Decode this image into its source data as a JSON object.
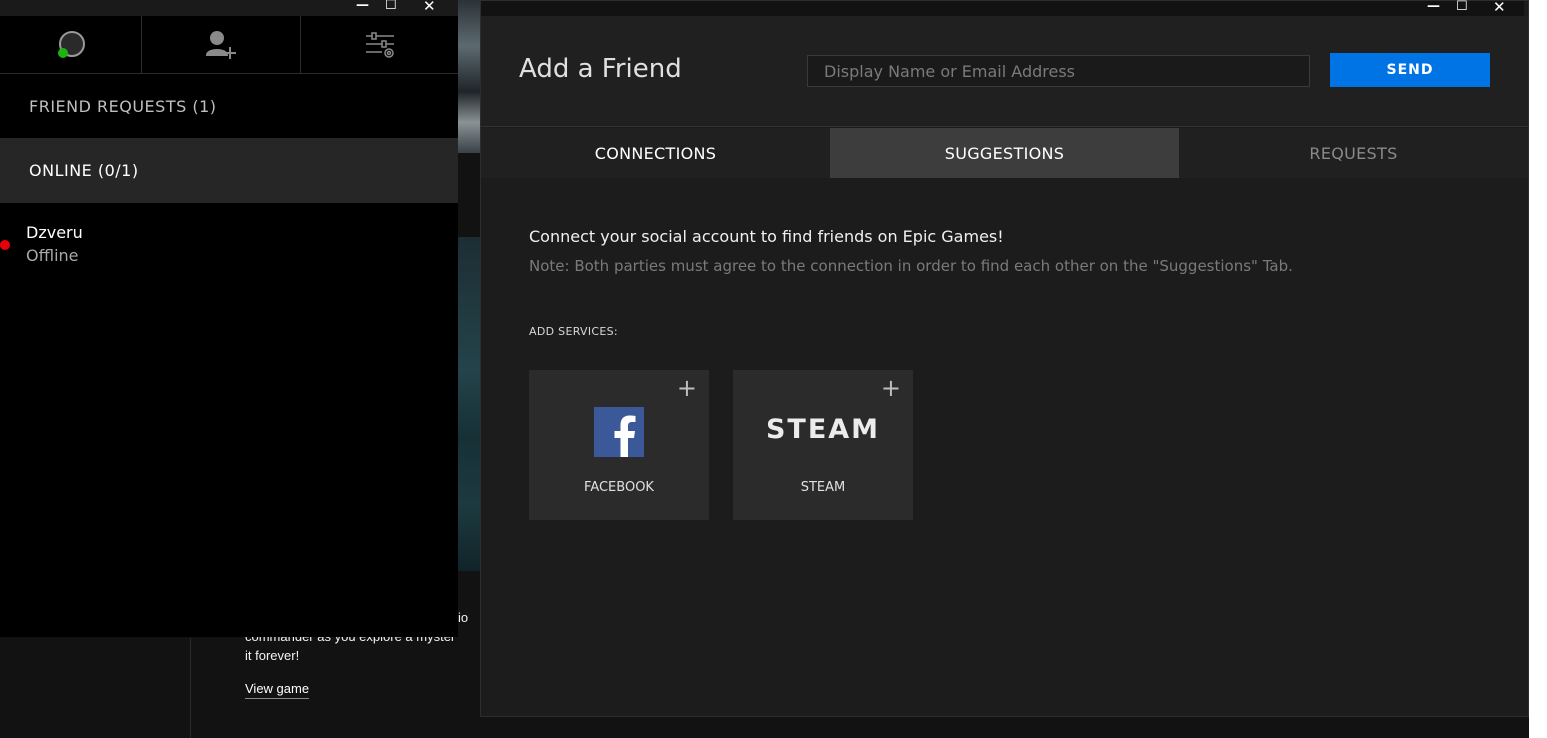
{
  "background_store": {
    "description_line1": "ictio",
    "description_line2": "commander as you explore a myster",
    "description_line3": "it forever!",
    "view_game_link": "View game"
  },
  "friends_panel": {
    "window_controls": {
      "minimize": "—",
      "maximize": "☐",
      "close": "✕"
    },
    "toolbar_icons": [
      "status-icon",
      "add-friend-icon",
      "settings-icon"
    ],
    "status_color": "#1db311",
    "friend_requests_label": "FRIEND REQUESTS (1)",
    "online_label": "ONLINE (0/1)",
    "friends": [
      {
        "name": "Dzveru",
        "status": "Offline",
        "status_color": "#e8000b"
      }
    ]
  },
  "add_friend_window": {
    "window_controls": {
      "minimize": "—",
      "maximize": "☐",
      "close": "✕"
    },
    "title": "Add a Friend",
    "search_input": {
      "value": "",
      "placeholder": "Display Name or Email Address"
    },
    "send_label": "SEND",
    "accent_color": "#0074e4",
    "tabs": [
      {
        "label": "CONNECTIONS",
        "state": "normal"
      },
      {
        "label": "SUGGESTIONS",
        "state": "active"
      },
      {
        "label": "REQUESTS",
        "state": "dimmed"
      }
    ],
    "connect_text": "Connect your social account to find friends on Epic Games!",
    "note_text": "Note: Both parties must agree to the connection in order to find each other on the \"Suggestions\" Tab.",
    "add_services_label": "ADD SERVICES:",
    "services": [
      {
        "label": "FACEBOOK",
        "icon": "facebook-icon",
        "logo_color": "#3b5998"
      },
      {
        "label": "STEAM",
        "icon": "steam-logo",
        "wordmark": "STEAM"
      }
    ],
    "add_glyph": "+"
  }
}
